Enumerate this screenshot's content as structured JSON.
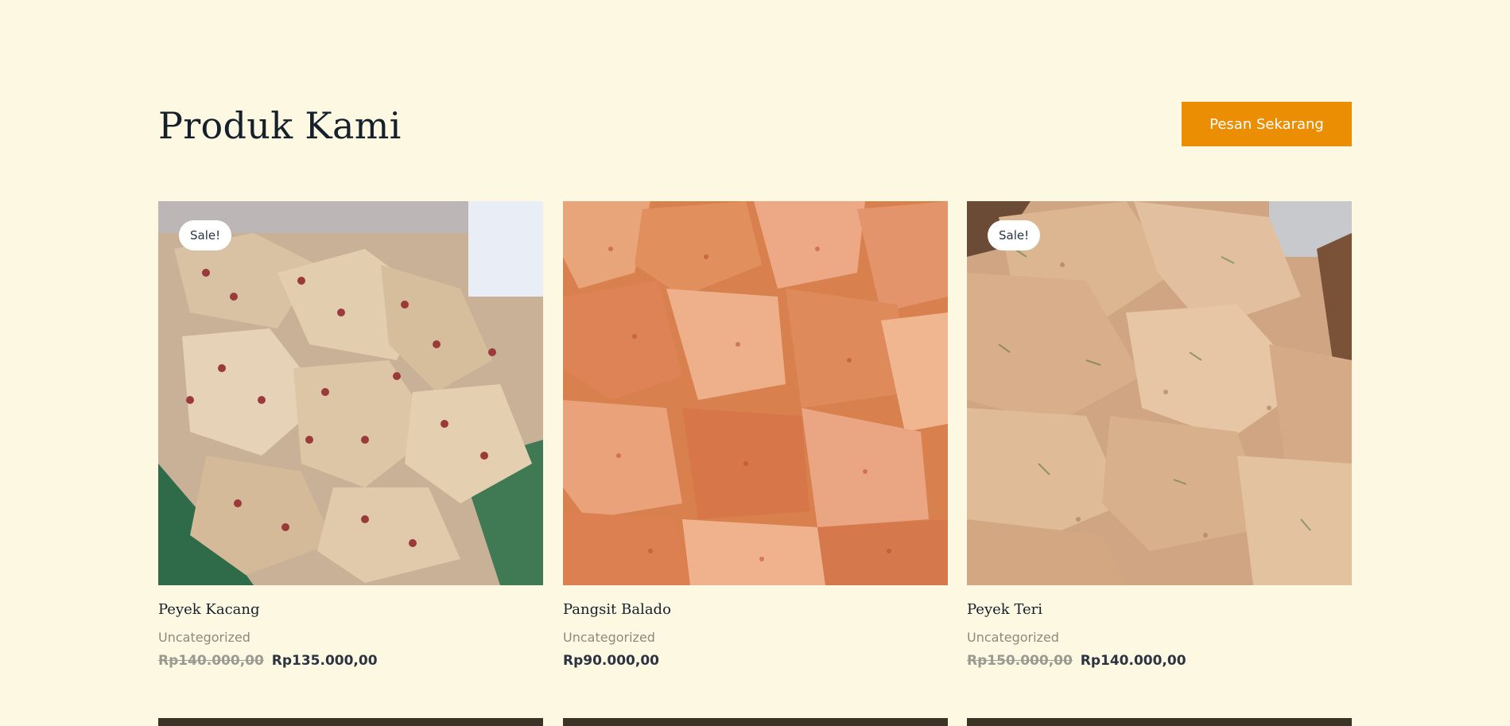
{
  "section": {
    "title": "Produk Kami",
    "cta_label": "Pesan Sekarang"
  },
  "colors": {
    "background": "#fdf8e1",
    "accent": "#ec8e04",
    "heading": "#15202b"
  },
  "products": [
    {
      "name": "Peyek Kacang",
      "category": "Uncategorized",
      "badge": "Sale!",
      "old_price": "Rp140.000,00",
      "price": "Rp135.000,00",
      "image_icon": "peanut-cracker-photo"
    },
    {
      "name": "Pangsit Balado",
      "category": "Uncategorized",
      "badge": "",
      "old_price": "",
      "price": "Rp90.000,00",
      "image_icon": "spicy-wonton-chips-photo"
    },
    {
      "name": "Peyek Teri",
      "category": "Uncategorized",
      "badge": "Sale!",
      "old_price": "Rp150.000,00",
      "price": "Rp140.000,00",
      "image_icon": "anchovy-cracker-photo"
    }
  ]
}
